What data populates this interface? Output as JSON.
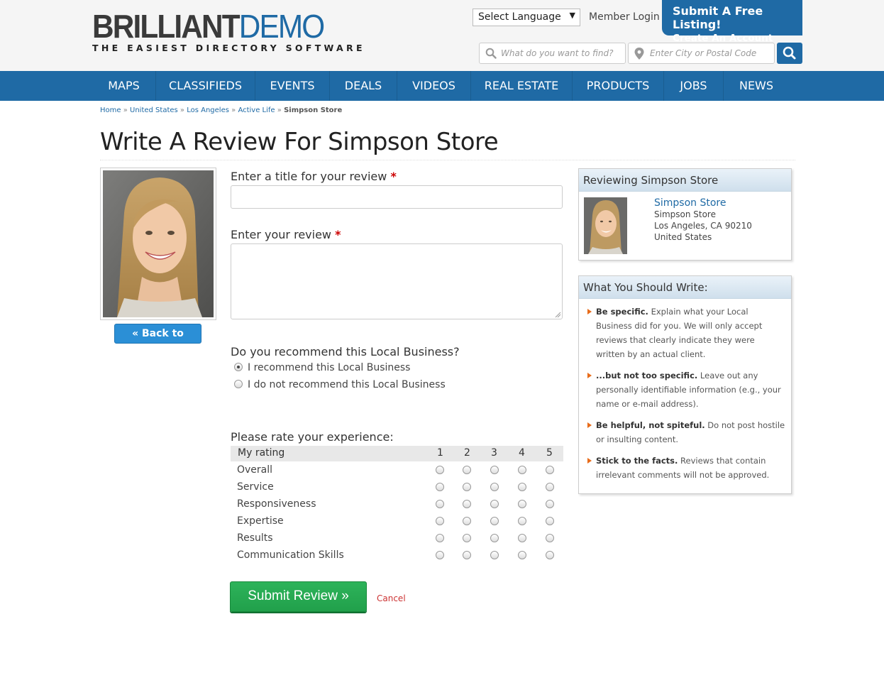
{
  "brand": {
    "name_part1": "BRILLIANT",
    "name_part2": "DEMO",
    "tagline": "THE EASIEST DIRECTORY SOFTWARE",
    "primary_color": "#1f6aa5"
  },
  "header": {
    "language_select": "Select Language",
    "member_login": "Member Login",
    "submit_listing_line1": "Submit A Free Listing!",
    "submit_listing_line2": "Create An Account >>>",
    "search_placeholder": "What do you want to find?",
    "location_placeholder": "Enter City or Postal Code"
  },
  "nav": [
    "MAPS",
    "CLASSIFIEDS",
    "EVENTS",
    "DEALS",
    "VIDEOS",
    "REAL ESTATE",
    "PRODUCTS",
    "JOBS",
    "NEWS"
  ],
  "breadcrumb": [
    "Home",
    "United States",
    "Los Angeles",
    "Active Life",
    "Simpson Store"
  ],
  "page_title": "Write A Review For Simpson Store",
  "back_button": "« Back to listing",
  "form": {
    "title_label": "Enter a title for your review",
    "review_label": "Enter your review",
    "required_mark": "*",
    "recommend_question": "Do you recommend this Local Business?",
    "recommend_yes": "I recommend this Local Business",
    "recommend_no": "I do not recommend this Local Business",
    "rate_heading": "Please rate your experience:",
    "rating_header": "My rating",
    "rating_scale": [
      "1",
      "2",
      "3",
      "4",
      "5"
    ],
    "rating_rows": [
      "Overall",
      "Service",
      "Responsiveness",
      "Expertise",
      "Results",
      "Communication Skills"
    ],
    "submit": "Submit Review »",
    "cancel": "Cancel"
  },
  "reviewing_box": {
    "heading": "Reviewing Simpson Store",
    "name": "Simpson Store",
    "address_line1": "Simpson Store",
    "address_line2": "Los Angeles, CA 90210",
    "address_line3": "United States"
  },
  "tips_box": {
    "heading": "What You Should Write:",
    "tips": [
      {
        "bold": "Be specific.",
        "text": " Explain what your Local Business did for you. We will only accept reviews that clearly indicate they were written by an actual client."
      },
      {
        "bold": "...but not too specific.",
        "text": " Leave out any personally identifiable information (e.g., your name or e-mail address)."
      },
      {
        "bold": "Be helpful, not spiteful.",
        "text": " Do not post hostile or insulting content."
      },
      {
        "bold": "Stick to the facts.",
        "text": " Reviews that contain irrelevant comments will not be approved."
      }
    ]
  }
}
